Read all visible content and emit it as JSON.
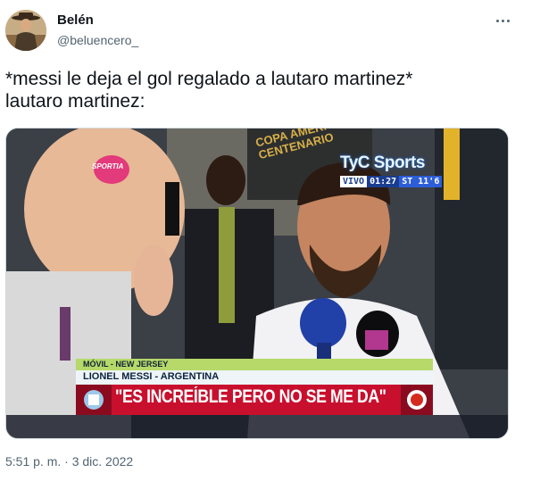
{
  "user": {
    "display_name": "Belén",
    "handle": "@beluencero_"
  },
  "tweet": {
    "lines": [
      "*messi le deja el gol regalado a lautaro martinez*",
      "lautaro martinez:"
    ],
    "timestamp": "5:51 p. m. · 3 dic. 2022"
  },
  "media": {
    "broadcaster": "TyC Sports",
    "live_label": "VIVO",
    "clock": "01:27",
    "period": "ST 11'6",
    "location": "MÓVIL - NEW JERSEY",
    "player": "LIONEL MESSI - ARGENTINA",
    "quote": "\"ES INCREÍBLE PERO NO SE ME DA\"",
    "backdrop_text": "COPA AMERICA CENTENARIO",
    "mic_logo": "SPORTIA"
  },
  "icons": {
    "more": "more-dots-icon"
  },
  "colors": {
    "text_primary": "#0f1419",
    "text_secondary": "#536471",
    "lower_third_red": "#c8102e",
    "lower_third_green": "#b6d96a"
  }
}
